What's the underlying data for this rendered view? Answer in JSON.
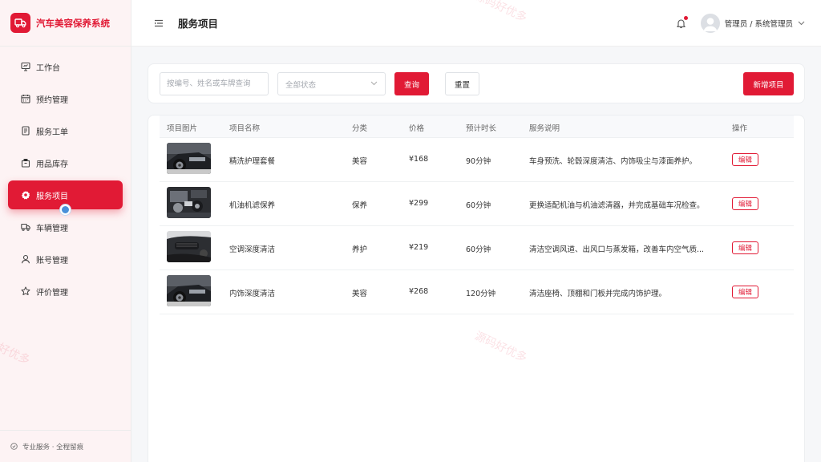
{
  "app": {
    "title": "汽车美容保养系统"
  },
  "sidebar": {
    "items": [
      {
        "label": "工作台",
        "icon": "monitor-icon",
        "active": false
      },
      {
        "label": "预约管理",
        "icon": "calendar-icon",
        "active": false
      },
      {
        "label": "服务工单",
        "icon": "document-icon",
        "active": false
      },
      {
        "label": "用品库存",
        "icon": "box-icon",
        "active": false
      },
      {
        "label": "服务项目",
        "icon": "gear-icon",
        "active": true
      },
      {
        "label": "车辆管理",
        "icon": "truck-icon",
        "active": false
      },
      {
        "label": "账号管理",
        "icon": "user-icon",
        "active": false
      },
      {
        "label": "评价管理",
        "icon": "star-icon",
        "active": false
      }
    ],
    "footer": "专业服务 · 全程留痕"
  },
  "header": {
    "page_title": "服务项目",
    "user_label": "管理员 / 系统管理员"
  },
  "filters": {
    "search_placeholder": "按编号、姓名或车牌查询",
    "status_value": "全部状态",
    "query_label": "查询",
    "reset_label": "重置",
    "add_label": "新增项目"
  },
  "table": {
    "columns": [
      "项目图片",
      "项目名称",
      "分类",
      "价格",
      "预计时长",
      "服务说明",
      "操作"
    ],
    "rows": [
      {
        "name": "精洗护理套餐",
        "category": "美容",
        "price": "¥168",
        "duration": "90分钟",
        "description": "车身预洗、轮毂深度清洁、内饰吸尘与漆面养护。",
        "action": "编辑"
      },
      {
        "name": "机油机滤保养",
        "category": "保养",
        "price": "¥299",
        "duration": "60分钟",
        "description": "更换适配机油与机油滤清器，并完成基础车况检查。",
        "action": "编辑"
      },
      {
        "name": "空调深度清洁",
        "category": "养护",
        "price": "¥219",
        "duration": "60分钟",
        "description": "清洁空调风道、出风口与蒸发箱，改善车内空气质...",
        "action": "编辑"
      },
      {
        "name": "内饰深度清洁",
        "category": "美容",
        "price": "¥268",
        "duration": "120分钟",
        "description": "清洁座椅、顶棚和门板并完成内饰护理。",
        "action": "编辑"
      }
    ]
  },
  "watermark": "源码好优多",
  "colors": {
    "accent": "#e11a35",
    "active_dot": "#4a90d9"
  }
}
